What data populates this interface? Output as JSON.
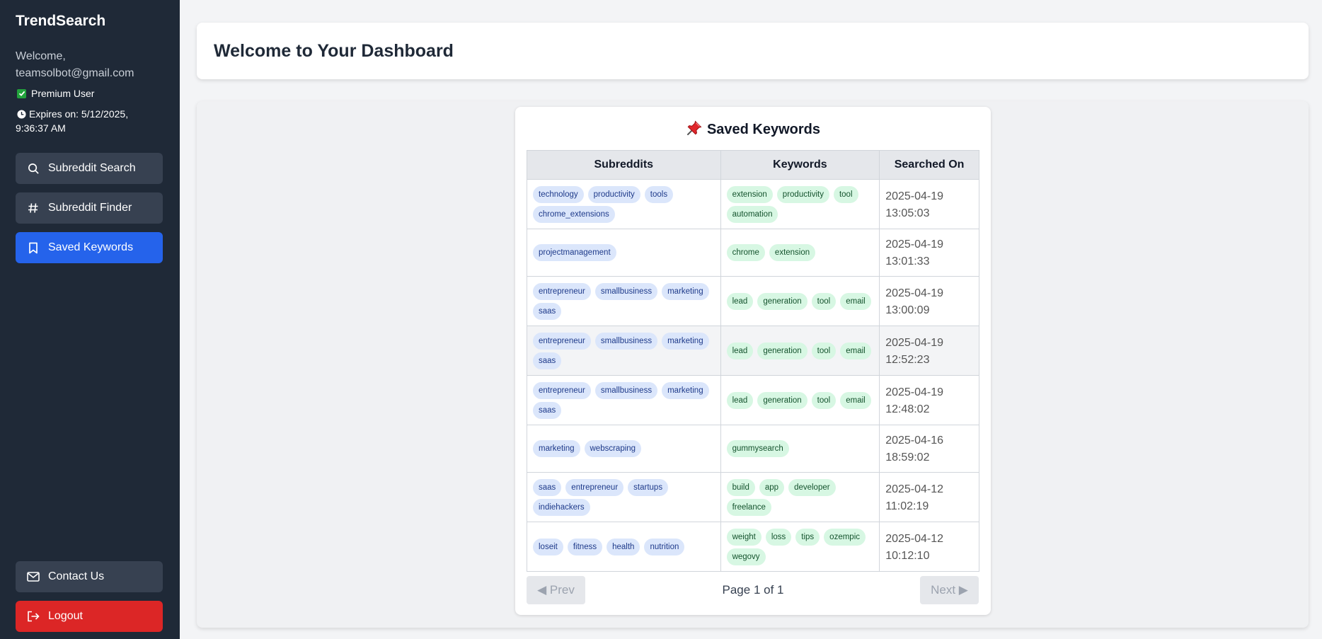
{
  "app": {
    "brand": "TrendSearch"
  },
  "user": {
    "welcome": "Welcome,",
    "email": "teamsolbot@gmail.com",
    "status": "Premium User",
    "expires": "Expires on: 5/12/2025, 9:36:37 AM"
  },
  "nav": {
    "subreddit_search": "Subreddit Search",
    "subreddit_finder": "Subreddit Finder",
    "saved_keywords": "Saved Keywords",
    "contact": "Contact Us",
    "logout": "Logout"
  },
  "header": {
    "title": "Welcome to Your Dashboard"
  },
  "saved": {
    "title": "Saved Keywords",
    "columns": {
      "subreddits": "Subreddits",
      "keywords": "Keywords",
      "searched_on": "Searched On"
    },
    "rows": [
      {
        "subreddits": [
          "technology",
          "productivity",
          "tools",
          "chrome_extensions"
        ],
        "keywords": [
          "extension",
          "productivity",
          "tool",
          "automation"
        ],
        "date": "2025-04-19 13:05:03"
      },
      {
        "subreddits": [
          "projectmanagement"
        ],
        "keywords": [
          "chrome",
          "extension"
        ],
        "date": "2025-04-19 13:01:33"
      },
      {
        "subreddits": [
          "entrepreneur",
          "smallbusiness",
          "marketing",
          "saas"
        ],
        "keywords": [
          "lead",
          "generation",
          "tool",
          "email"
        ],
        "date": "2025-04-19 13:00:09"
      },
      {
        "subreddits": [
          "entrepreneur",
          "smallbusiness",
          "marketing",
          "saas"
        ],
        "keywords": [
          "lead",
          "generation",
          "tool",
          "email"
        ],
        "date": "2025-04-19 12:52:23"
      },
      {
        "subreddits": [
          "entrepreneur",
          "smallbusiness",
          "marketing",
          "saas"
        ],
        "keywords": [
          "lead",
          "generation",
          "tool",
          "email"
        ],
        "date": "2025-04-19 12:48:02"
      },
      {
        "subreddits": [
          "marketing",
          "webscraping"
        ],
        "keywords": [
          "gummysearch"
        ],
        "date": "2025-04-16 18:59:02"
      },
      {
        "subreddits": [
          "saas",
          "entrepreneur",
          "startups",
          "indiehackers"
        ],
        "keywords": [
          "build",
          "app",
          "developer",
          "freelance"
        ],
        "date": "2025-04-12 11:02:19"
      },
      {
        "subreddits": [
          "loseit",
          "fitness",
          "health",
          "nutrition"
        ],
        "keywords": [
          "weight",
          "loss",
          "tips",
          "ozempic",
          "wegovy"
        ],
        "date": "2025-04-12 10:12:10"
      }
    ],
    "pagination": {
      "prev": "◀ Prev",
      "next": "Next ▶",
      "page_info": "Page 1 of 1"
    }
  },
  "colors": {
    "sidebar": "#1f2937",
    "active": "#2563eb",
    "logout": "#dc2626"
  }
}
